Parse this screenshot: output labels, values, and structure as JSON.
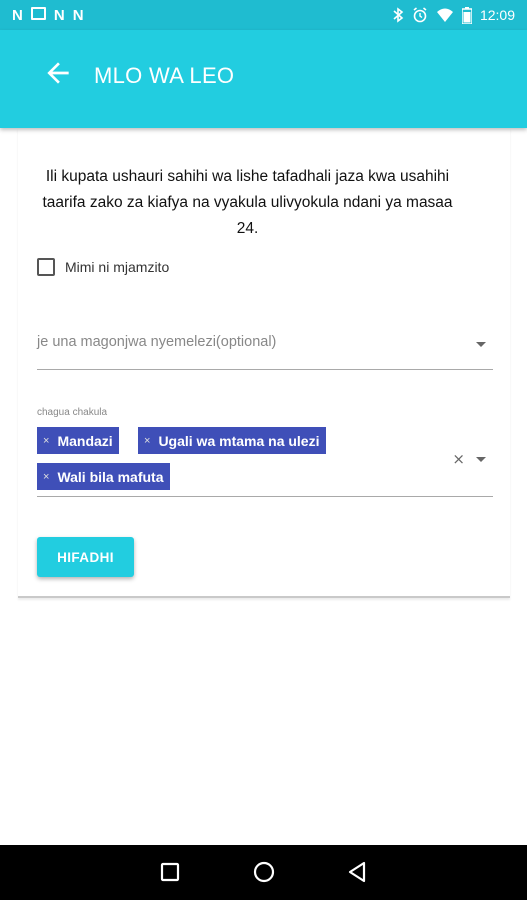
{
  "status_bar": {
    "notifications": [
      "N",
      "N",
      "N"
    ],
    "time": "12:09",
    "icons": [
      "bluetooth-icon",
      "alarm-icon",
      "wifi-icon",
      "battery-icon"
    ]
  },
  "app_bar": {
    "title": "MLO WA LEO",
    "back_icon": "arrow-left-icon"
  },
  "form": {
    "intro": "Ili kupata ushauri sahihi wa lishe tafadhali jaza kwa usahihi taarifa zako za kiafya na vyakula ulivyokula ndani ya masaa 24.",
    "pregnant_label": "Mimi ni mjamzito",
    "pregnant_checked": false,
    "disease_placeholder": "je una magonjwa nyemelezi(optional)",
    "food_label": "chagua chakula",
    "selected_foods": [
      "Mandazi",
      "Ugali wa mtama na ulezi",
      "Wali bila mafuta"
    ],
    "chip_remove_symbol": "×",
    "clear_symbol": "×",
    "save_label": "HIFADHI"
  },
  "nav_bar": {
    "buttons": [
      "square-recents-icon",
      "circle-home-icon",
      "triangle-back-icon"
    ]
  },
  "colors": {
    "primary": "#22cde0",
    "status_bar": "#1fbcd0",
    "chip": "#3f4fb8"
  }
}
